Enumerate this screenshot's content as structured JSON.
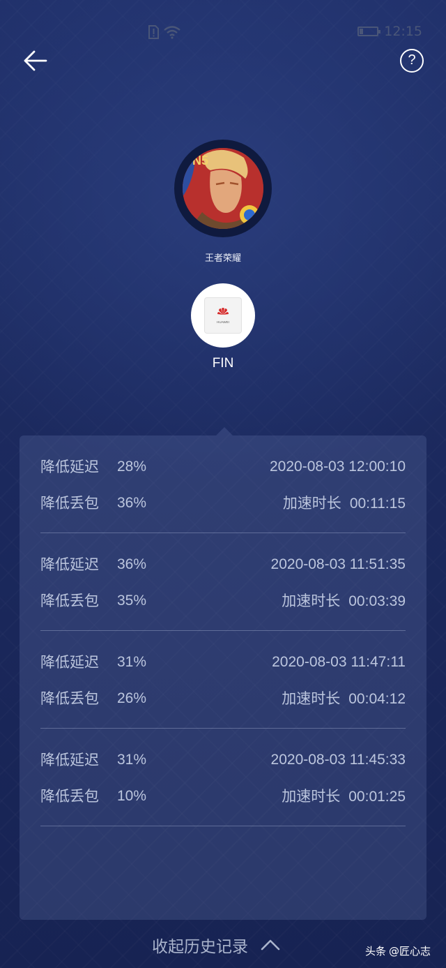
{
  "status_bar": {
    "time": "12:15",
    "icons": [
      "sim-alert-icon",
      "wifi-icon",
      "battery-icon"
    ],
    "battery_level": 0.2
  },
  "nav": {
    "back_icon": "arrow-left-icon",
    "help_label": "?"
  },
  "game": {
    "name": "王者荣耀"
  },
  "device": {
    "name": "FIN",
    "logo_text": "HUAWEI"
  },
  "history": {
    "records": [
      {
        "latency_label": "降低延迟",
        "latency_value": "28%",
        "timestamp": "2020-08-03 12:00:10",
        "packet_label": "降低丢包",
        "packet_value": "36%",
        "duration_label": "加速时长",
        "duration_value": "00:11:15"
      },
      {
        "latency_label": "降低延迟",
        "latency_value": "36%",
        "timestamp": "2020-08-03 11:51:35",
        "packet_label": "降低丢包",
        "packet_value": "35%",
        "duration_label": "加速时长",
        "duration_value": "00:03:39"
      },
      {
        "latency_label": "降低延迟",
        "latency_value": "31%",
        "timestamp": "2020-08-03 11:47:11",
        "packet_label": "降低丢包",
        "packet_value": "26%",
        "duration_label": "加速时长",
        "duration_value": "00:04:12"
      },
      {
        "latency_label": "降低延迟",
        "latency_value": "31%",
        "timestamp": "2020-08-03 11:45:33",
        "packet_label": "降低丢包",
        "packet_value": "10%",
        "duration_label": "加速时长",
        "duration_value": "00:01:25"
      }
    ]
  },
  "collapse": {
    "label": "收起历史记录",
    "icon": "chevron-up-icon"
  },
  "watermark": {
    "brand": "头条",
    "handle": "@匠心志"
  }
}
